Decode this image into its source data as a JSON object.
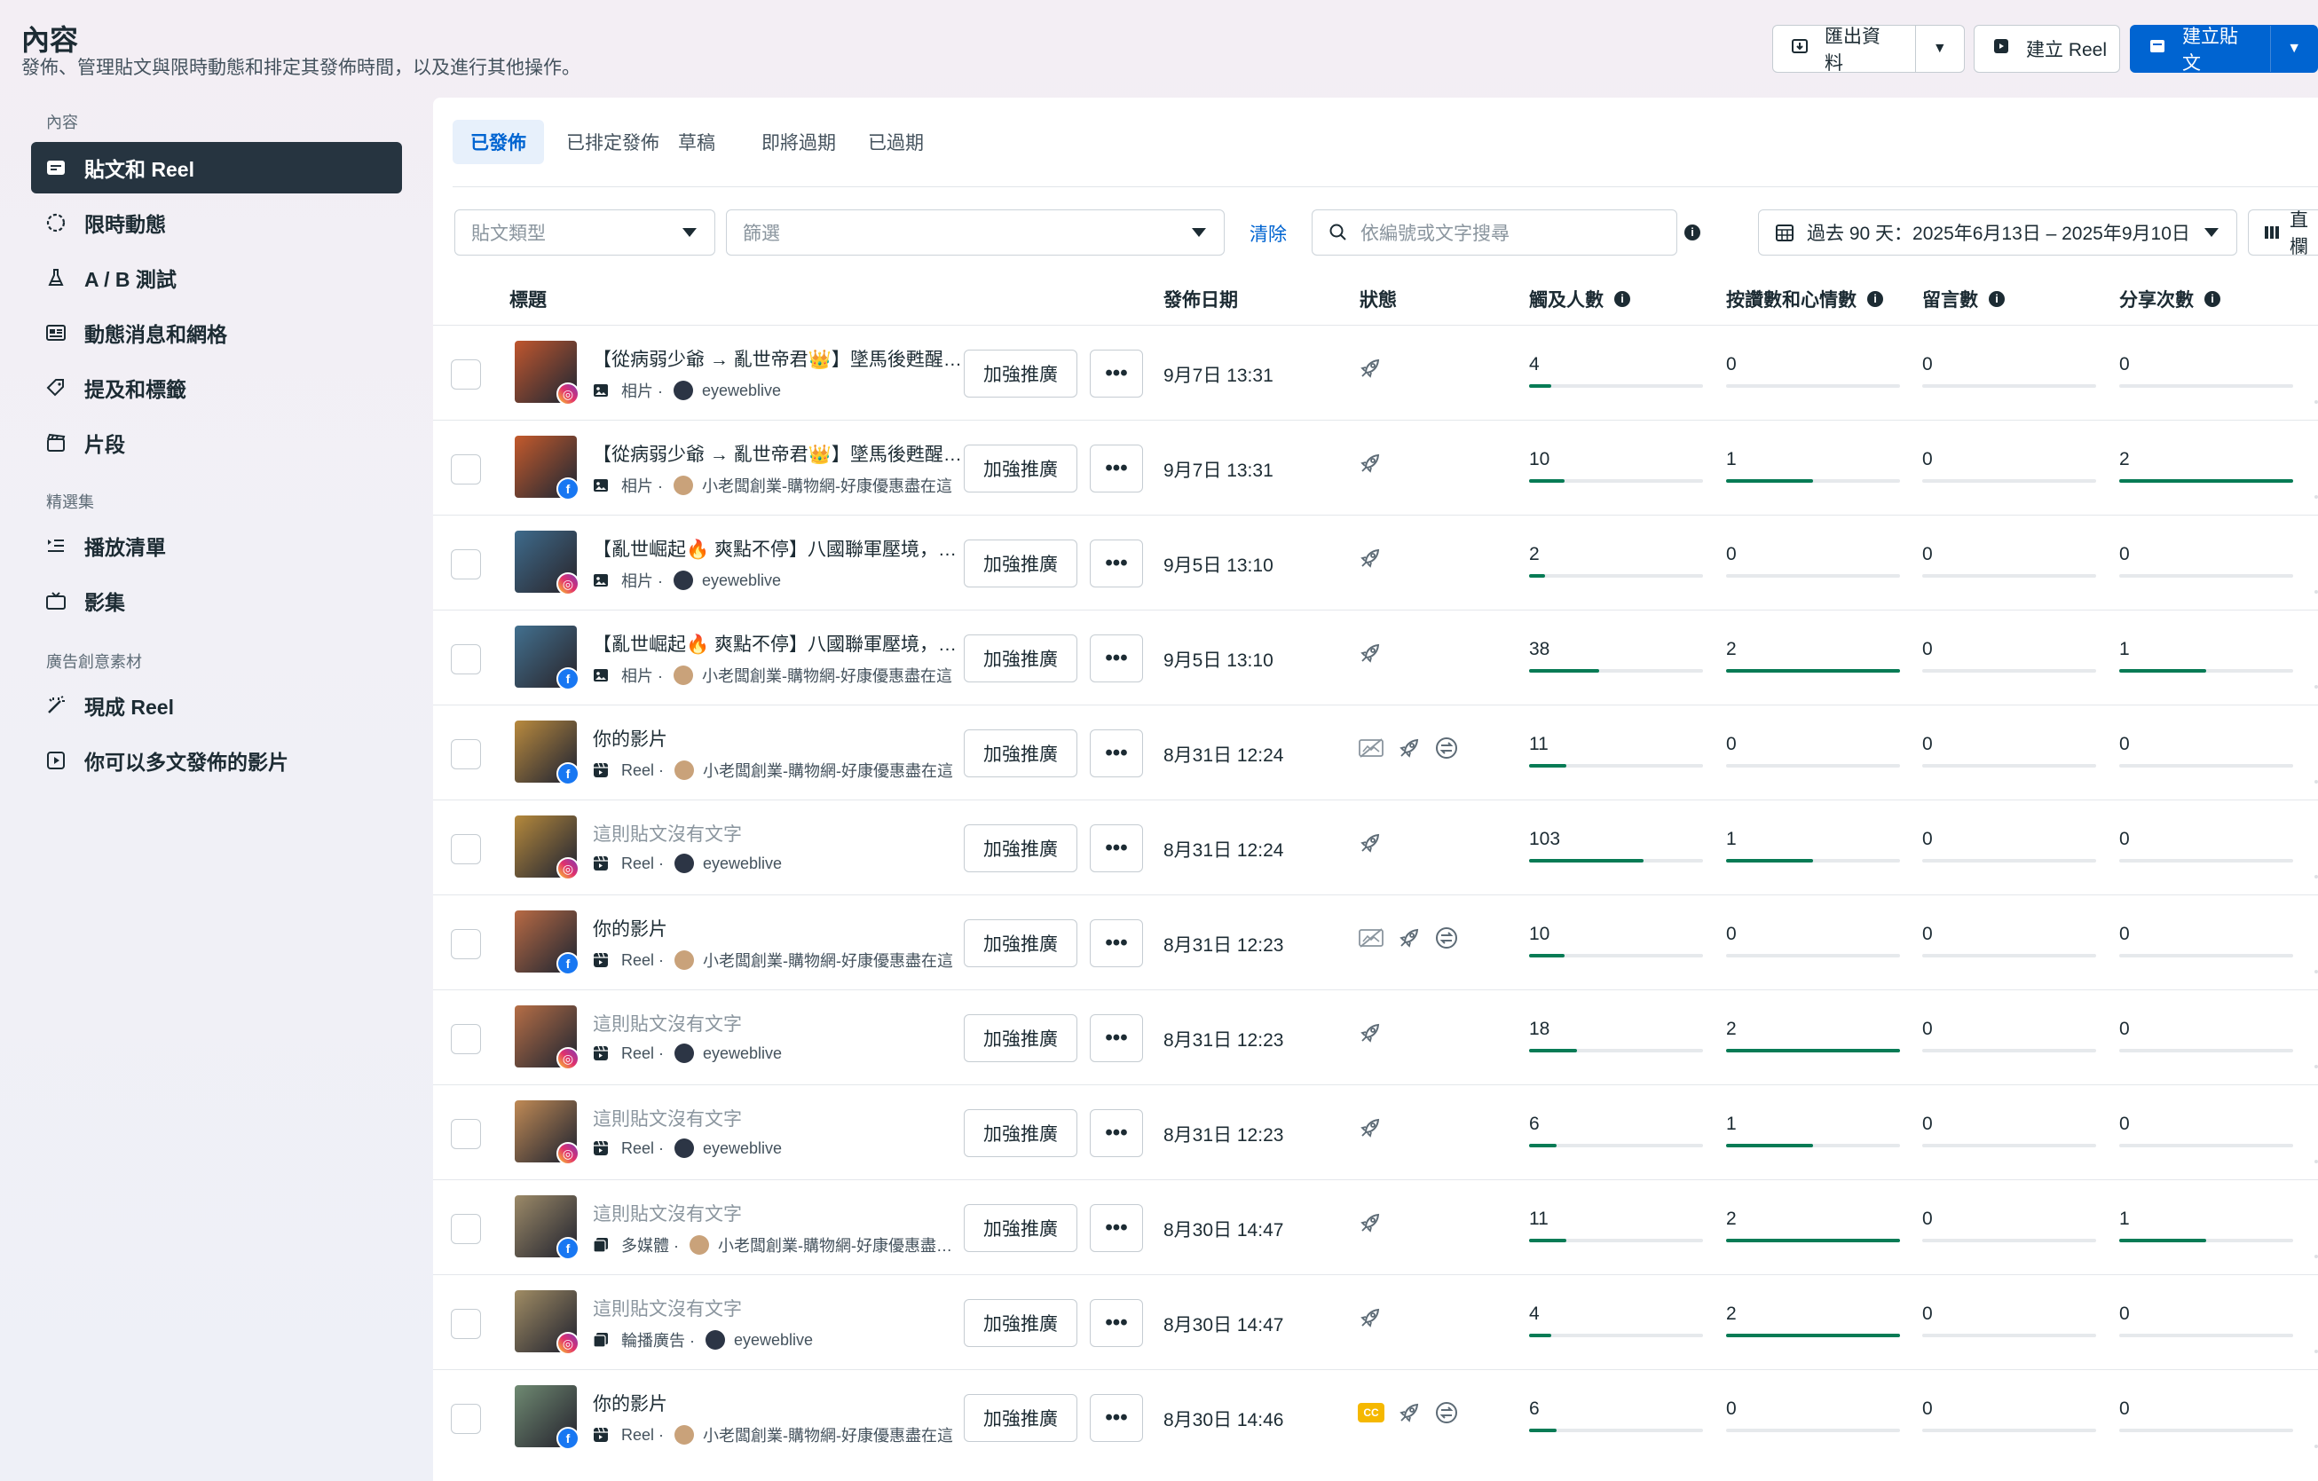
{
  "header": {
    "title": "內容",
    "subtitle": "發佈、管理貼文與限時動態和排定其發佈時間，以及進行其他操作。",
    "export_label": "匯出資料",
    "create_reel_label": "建立 Reel",
    "create_post_label": "建立貼文"
  },
  "sidebar": {
    "section_content": "內容",
    "items_content": [
      {
        "label": "貼文和 Reel",
        "icon": "posts-icon",
        "active": true
      },
      {
        "label": "限時動態",
        "icon": "stories-icon"
      },
      {
        "label": "A / B 測試",
        "icon": "flask-icon"
      },
      {
        "label": "動態消息和網格",
        "icon": "feed-grid-icon"
      },
      {
        "label": "提及和標籤",
        "icon": "tag-icon"
      },
      {
        "label": "片段",
        "icon": "clip-icon"
      }
    ],
    "section_collections": "精選集",
    "items_collections": [
      {
        "label": "播放清單",
        "icon": "playlist-icon"
      },
      {
        "label": "影集",
        "icon": "tv-icon"
      }
    ],
    "section_ads": "廣告創意素材",
    "items_ads": [
      {
        "label": "現成 Reel",
        "icon": "magic-wand-icon"
      },
      {
        "label": "你可以多文發佈的影片",
        "icon": "video-play-icon"
      }
    ]
  },
  "tabs": [
    "已發佈",
    "已排定發佈",
    "草稿",
    "即將過期",
    "已過期"
  ],
  "filters": {
    "post_type_placeholder": "貼文類型",
    "filter_placeholder": "篩選",
    "clear_label": "清除",
    "search_placeholder": "依編號或文字搜尋",
    "date_range": "過去 90 天：2025年6月13日 – 2025年9月10日",
    "columns_label": "直欄"
  },
  "table": {
    "headers": {
      "title": "標題",
      "date": "發佈日期",
      "status": "狀態",
      "reach": "觸及人數",
      "reactions": "按讚數和心情數",
      "comments": "留言數",
      "shares": "分享次數"
    },
    "boost_label": "加強推廣",
    "more_label": "•••",
    "rows": [
      {
        "title": "【從病弱少爺 → 亂世帝君👑】墜馬後甦醒，竟然成了天命之子！",
        "muted": false,
        "type": "相片 ·",
        "type_icon": "photo-icon",
        "owner": "eyeweblive",
        "platform": "ig",
        "date": "9月7日 13:31",
        "status": [
          "boost-rocket-icon"
        ],
        "reach": 4,
        "reactions": 0,
        "comments": 0,
        "shares": 0,
        "thumb_color": "#c0562e"
      },
      {
        "title": "【從病弱少爺 → 亂世帝君👑】墜馬後甦醒，竟然成了天命之子！",
        "muted": false,
        "type": "相片 ·",
        "type_icon": "photo-icon",
        "owner": "小老闆創業-購物網-好康優惠盡在這",
        "platform": "fb",
        "date": "9月7日 13:31",
        "status": [
          "boost-rocket-icon"
        ],
        "reach": 10,
        "reactions": 1,
        "comments": 0,
        "shares": 2,
        "thumb_color": "#c45a2c"
      },
      {
        "title": "【亂世崛起🔥 爽點不停】八國聯軍壓境，他一人逆轉乾坤！",
        "muted": false,
        "type": "相片 ·",
        "type_icon": "photo-icon",
        "owner": "eyeweblive",
        "platform": "ig",
        "date": "9月5日 13:10",
        "status": [
          "boost-rocket-icon"
        ],
        "reach": 2,
        "reactions": 0,
        "comments": 0,
        "shares": 0,
        "thumb_color": "#3e6b8c"
      },
      {
        "title": "【亂世崛起🔥 爽點不停】八國聯軍壓境，他一人逆轉乾坤！",
        "muted": false,
        "type": "相片 ·",
        "type_icon": "photo-icon",
        "owner": "小老闆創業-購物網-好康優惠盡在這",
        "platform": "fb",
        "date": "9月5日 13:10",
        "status": [
          "boost-rocket-icon"
        ],
        "reach": 38,
        "reactions": 2,
        "comments": 0,
        "shares": 1,
        "thumb_color": "#42708f"
      },
      {
        "title": "你的影片",
        "muted": false,
        "type": "Reel ·",
        "type_icon": "reel-icon",
        "owner": "小老闆創業-購物網-好康優惠盡在這",
        "platform": "fb",
        "date": "8月31日 12:24",
        "status": [
          "no-ad-icon",
          "boost-rocket-icon",
          "crosspost-icon"
        ],
        "reach": 11,
        "reactions": 0,
        "comments": 0,
        "shares": 0,
        "thumb_color": "#b98a3e"
      },
      {
        "title": "這則貼文沒有文字",
        "muted": true,
        "type": "Reel ·",
        "type_icon": "reel-icon",
        "owner": "eyeweblive",
        "platform": "ig",
        "date": "8月31日 12:24",
        "status": [
          "boost-rocket-icon"
        ],
        "reach": 103,
        "reactions": 1,
        "comments": 0,
        "shares": 0,
        "thumb_color": "#b5893c"
      },
      {
        "title": "你的影片",
        "muted": false,
        "type": "Reel ·",
        "type_icon": "reel-icon",
        "owner": "小老闆創業-購物網-好康優惠盡在這",
        "platform": "fb",
        "date": "8月31日 12:23",
        "status": [
          "no-ad-icon",
          "boost-rocket-icon",
          "crosspost-icon"
        ],
        "reach": 10,
        "reactions": 0,
        "comments": 0,
        "shares": 0,
        "thumb_color": "#b86a44"
      },
      {
        "title": "這則貼文沒有文字",
        "muted": true,
        "type": "Reel ·",
        "type_icon": "reel-icon",
        "owner": "eyeweblive",
        "platform": "ig",
        "date": "8月31日 12:23",
        "status": [
          "boost-rocket-icon"
        ],
        "reach": 18,
        "reactions": 2,
        "comments": 0,
        "shares": 0,
        "thumb_color": "#b66e46"
      },
      {
        "title": "這則貼文沒有文字",
        "muted": true,
        "type": "Reel ·",
        "type_icon": "reel-icon",
        "owner": "eyeweblive",
        "platform": "ig",
        "date": "8月31日 12:23",
        "status": [
          "boost-rocket-icon"
        ],
        "reach": 6,
        "reactions": 1,
        "comments": 0,
        "shares": 0,
        "thumb_color": "#c08a55"
      },
      {
        "title": "這則貼文沒有文字",
        "muted": true,
        "type": "多媒體 ·",
        "type_icon": "multimedia-icon",
        "owner": "小老闆創業-購物網-好康優惠盡在這",
        "platform": "fb",
        "date": "8月30日 14:47",
        "status": [
          "boost-rocket-icon"
        ],
        "reach": 11,
        "reactions": 2,
        "comments": 0,
        "shares": 1,
        "thumb_color": "#9c8a68"
      },
      {
        "title": "這則貼文沒有文字",
        "muted": true,
        "type": "輪播廣告 ·",
        "type_icon": "carousel-icon",
        "owner": "eyeweblive",
        "platform": "ig",
        "date": "8月30日 14:47",
        "status": [
          "boost-rocket-icon"
        ],
        "reach": 4,
        "reactions": 2,
        "comments": 0,
        "shares": 0,
        "thumb_color": "#a08c64"
      },
      {
        "title": "你的影片",
        "muted": false,
        "type": "Reel ·",
        "type_icon": "reel-icon",
        "owner": "小老闆創業-購物網-好康優惠盡在這",
        "platform": "fb",
        "date": "8月30日 14:46",
        "status": [
          "cc-icon",
          "boost-rocket-icon",
          "crosspost-icon"
        ],
        "reach": 6,
        "reactions": 0,
        "comments": 0,
        "shares": 0,
        "thumb_color": "#6f8a72"
      }
    ]
  },
  "colors": {
    "primary": "#0064d1",
    "bar": "#077b55",
    "sidebar_active": "#263440"
  }
}
